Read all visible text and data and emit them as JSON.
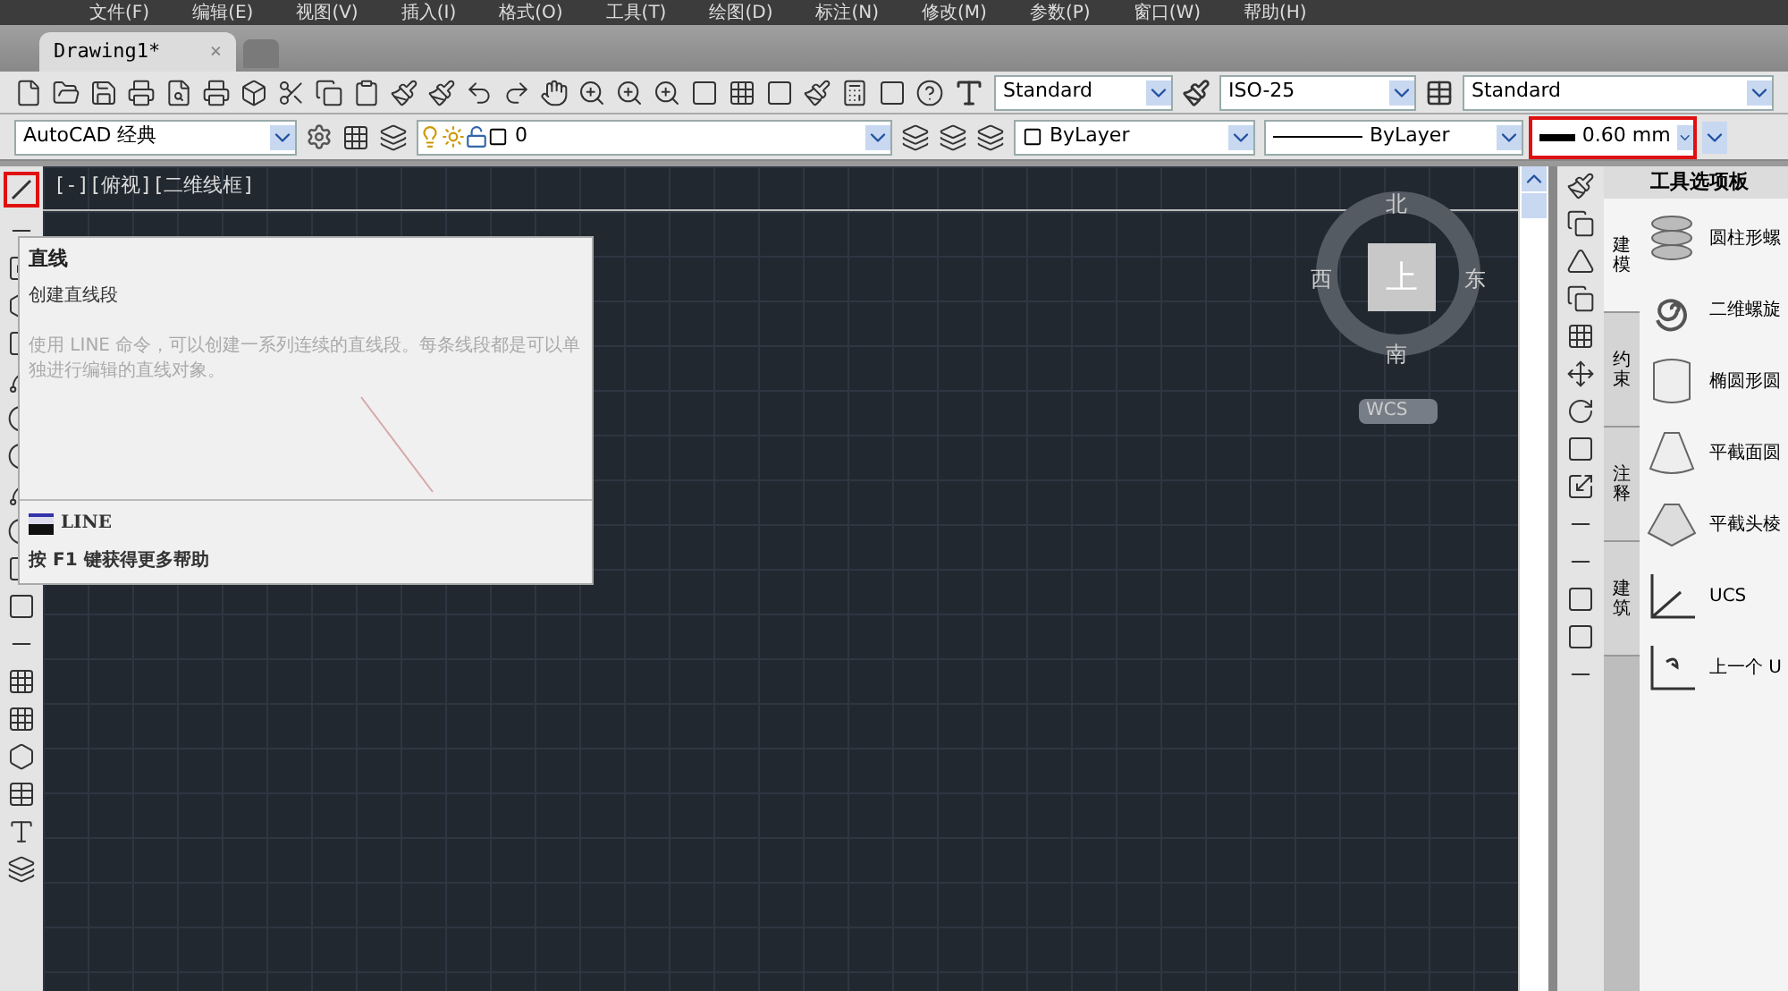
{
  "menu": [
    "文件(F)",
    "编辑(E)",
    "视图(V)",
    "插入(I)",
    "格式(O)",
    "工具(T)",
    "绘图(D)",
    "标注(N)",
    "修改(M)",
    "参数(P)",
    "窗口(W)",
    "帮助(H)"
  ],
  "tabs": [
    {
      "label": "Drawing1*",
      "selected": true,
      "close": "×"
    }
  ],
  "styles_toolbar": {
    "text_style": "Standard",
    "dim_style": "ISO-25",
    "table_style": "Standard"
  },
  "properties_toolbar": {
    "workspace": "AutoCAD 经典",
    "layer": "0",
    "color_setting": "ByLayer",
    "linetype": "ByLayer",
    "lineweight": "0.60 mm",
    "lineweight_highlighted": true
  },
  "draw_toolbar": {
    "line_highlighted": true
  },
  "viewport": {
    "label": "[-][俯视][二维线框]"
  },
  "viewcube": {
    "north": "北",
    "south": "南",
    "east": "东",
    "west": "西",
    "face": "上",
    "coords": "WCS"
  },
  "tooltip": {
    "title": "直线",
    "subtitle": "创建直线段",
    "description": "使用 LINE 命令，可以创建一系列连续的直线段。每条线段都是可以单独进行编辑的直线对象。",
    "command": "LINE",
    "help": "按 F1 键获得更多帮助"
  },
  "palette": {
    "title": "工具选项板",
    "tabs": [
      {
        "label": "建模",
        "selected": true
      },
      {
        "label": "约束",
        "selected": false
      },
      {
        "label": "注释",
        "selected": false
      },
      {
        "label": "建筑",
        "selected": false
      }
    ],
    "items": [
      {
        "label": "圆柱形螺",
        "kind": "helix"
      },
      {
        "label": "二维螺旋",
        "kind": "spiral"
      },
      {
        "label": "椭圆形圆",
        "kind": "cylinder"
      },
      {
        "label": "平截面圆",
        "kind": "cone"
      },
      {
        "label": "平截头棱",
        "kind": "pyramid"
      },
      {
        "label": "UCS",
        "kind": "ucs"
      },
      {
        "label": "上一个 U",
        "kind": "ucs-prev"
      }
    ]
  }
}
